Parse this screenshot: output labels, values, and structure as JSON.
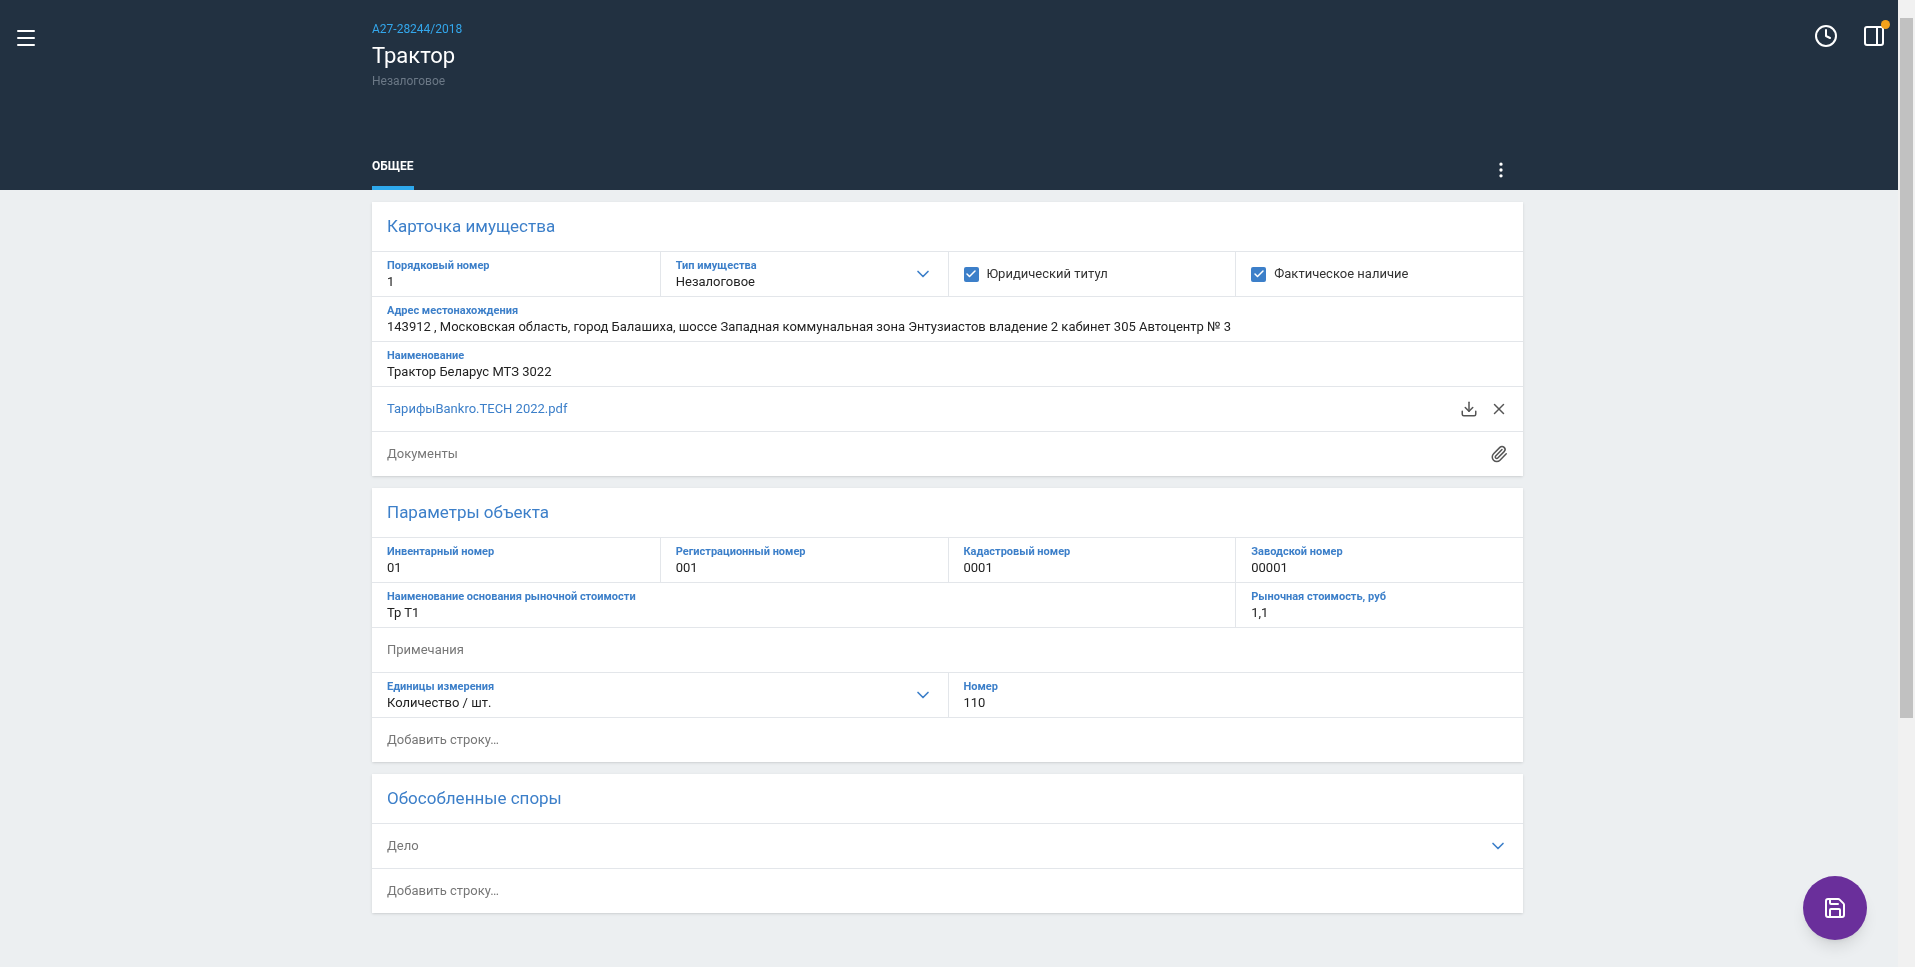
{
  "header": {
    "case_number": "А27-28244/2018",
    "title": "Трактор",
    "subtitle": "Незалоговое",
    "tabs": [
      {
        "label": "ОБЩЕЕ",
        "selected": true
      }
    ],
    "notification": true
  },
  "sections": [
    {
      "title": "Карточка имущества",
      "rows": [
        {
          "cells": [
            {
              "kind": "field",
              "label": "Порядковый номер",
              "value": "1"
            },
            {
              "kind": "select",
              "label": "Тип имущества",
              "value": "Незалоговое"
            },
            {
              "kind": "checkbox",
              "label": "Юридический титул",
              "checked": true
            },
            {
              "kind": "checkbox",
              "label": "Фактическое наличие",
              "checked": true
            }
          ]
        },
        {
          "cells": [
            {
              "kind": "field",
              "label": "Адрес местонахождения",
              "value": "143912 , Московская область, город Балашиха, шоссе Западная коммунальная зона Энтузиастов владение 2 кабинет 305 Автоцентр № 3"
            }
          ]
        },
        {
          "cells": [
            {
              "kind": "field",
              "label": "Наименование",
              "value": "Трактор Беларус МТЗ 3022"
            }
          ]
        },
        {
          "cells": [
            {
              "kind": "file",
              "name": "ТарифыBankro.TECH 2022.pdf"
            }
          ]
        },
        {
          "cells": [
            {
              "kind": "attach",
              "placeholder": "Документы"
            }
          ]
        }
      ]
    },
    {
      "title": "Параметры объекта",
      "rows": [
        {
          "cells": [
            {
              "kind": "field",
              "label": "Инвентарный номер",
              "value": "01"
            },
            {
              "kind": "field",
              "label": "Регистрационный номер",
              "value": "001"
            },
            {
              "kind": "field",
              "label": "Кадастровый номер",
              "value": "0001"
            },
            {
              "kind": "field",
              "label": "Заводской номер",
              "value": "00001"
            }
          ]
        },
        {
          "cells": [
            {
              "kind": "field",
              "label": "Наименование основания рыночной стоимости",
              "value": "Тр Т1"
            },
            "",
            "",
            {
              "kind": "field",
              "label": "Рыночная стоимость, руб",
              "value": "1,1"
            }
          ]
        },
        {
          "cells": [
            {
              "kind": "placeholder",
              "placeholder": "Примечания"
            }
          ]
        },
        {
          "cells": [
            {
              "kind": "select",
              "label": "Единицы измерения",
              "value": "Количество / шт."
            },
            "",
            {
              "kind": "field",
              "label": "Номер",
              "value": "110"
            },
            ""
          ]
        },
        {
          "cells": [
            {
              "kind": "placeholder",
              "placeholder": "Добавить строку…"
            }
          ]
        }
      ]
    },
    {
      "title": "Обособленные споры",
      "rows": [
        {
          "cells": [
            {
              "kind": "select_empty",
              "placeholder": "Дело"
            }
          ]
        },
        {
          "cells": [
            {
              "kind": "placeholder",
              "placeholder": "Добавить строку…"
            }
          ]
        }
      ]
    }
  ]
}
